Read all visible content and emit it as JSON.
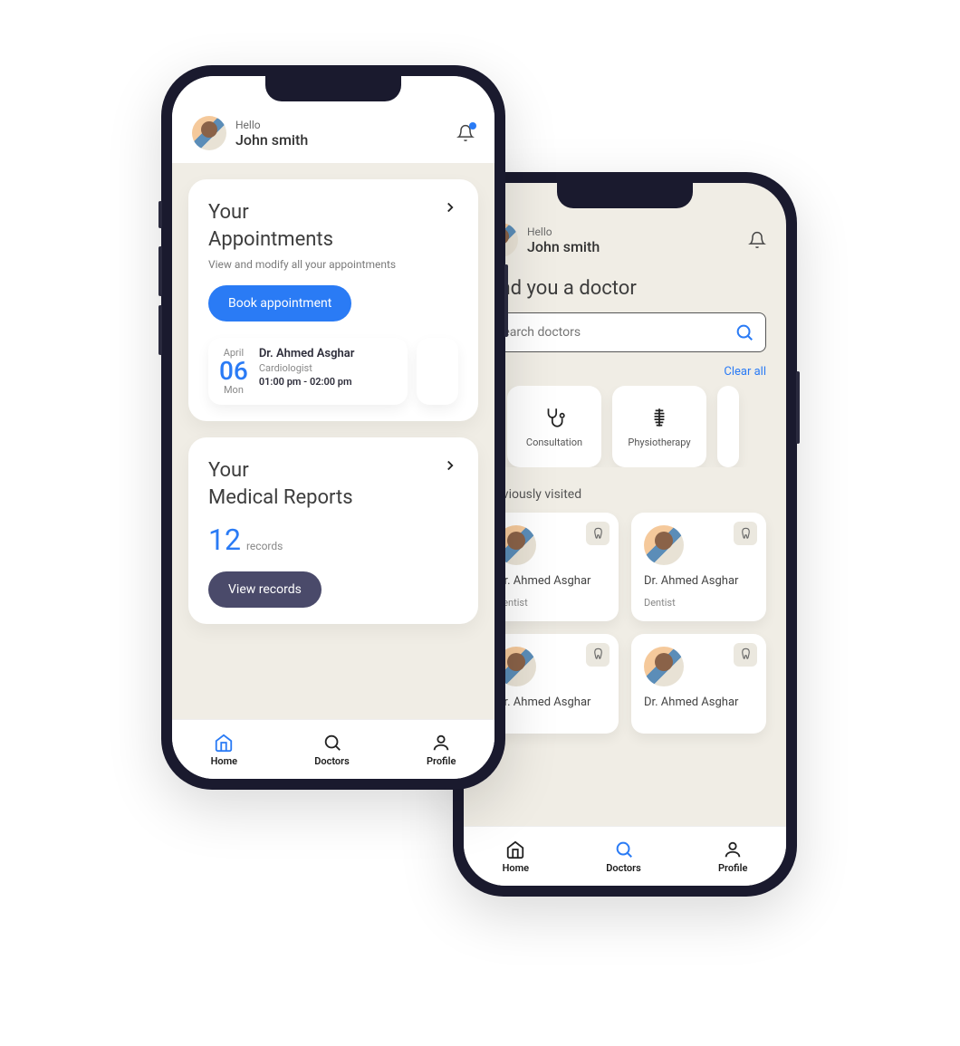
{
  "user": {
    "greeting": "Hello",
    "name": "John smith"
  },
  "home": {
    "appointments": {
      "title1": "Your",
      "title2": "Appointments",
      "subtitle": "View and modify all your appointments",
      "book_btn": "Book appointment",
      "item": {
        "month": "April",
        "day": "06",
        "dow": "Mon",
        "doctor": "Dr. Ahmed Asghar",
        "specialty": "Cardiologist",
        "time": "01:00 pm - 02:00 pm"
      }
    },
    "reports": {
      "title1": "Your",
      "title2": "Medical Reports",
      "count": "12",
      "count_label": "records",
      "view_btn": "View records"
    }
  },
  "doctors": {
    "page_title": "Find you a doctor",
    "search_placeholder": "Search doctors",
    "clear": "Clear all",
    "categories": [
      {
        "label": "Consultation"
      },
      {
        "label": "Physiotherapy"
      }
    ],
    "prev_label": "Previously visited",
    "items": [
      {
        "name": "Dr. Ahmed Asghar",
        "spec": "Dentist"
      },
      {
        "name": "Dr. Ahmed Asghar",
        "spec": "Dentist"
      },
      {
        "name": "Dr. Ahmed Asghar",
        "spec": ""
      },
      {
        "name": "Dr. Ahmed Asghar",
        "spec": ""
      }
    ]
  },
  "nav": {
    "home": "Home",
    "doctors": "Doctors",
    "profile": "Profile"
  }
}
